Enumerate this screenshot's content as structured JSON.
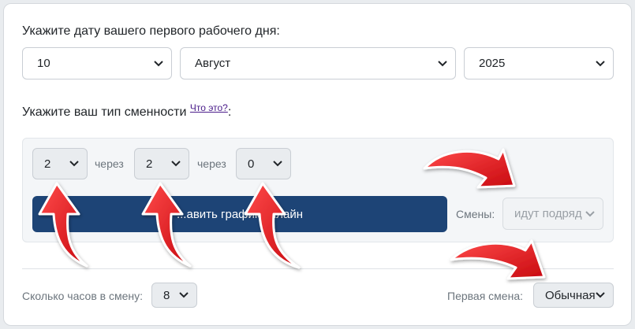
{
  "form": {
    "date_label": "Укажите дату вашего первого рабочего дня:",
    "day": "10",
    "month": "Август",
    "year": "2025",
    "shift_label": "Укажите ваш тип сменности",
    "what_link": "Что это?",
    "colon": ":",
    "pattern": {
      "a": "2",
      "through1": "через",
      "b": "2",
      "through2": "через",
      "c": "0"
    },
    "button_label": "...авить график онлайн",
    "shifts_label": "Смены:",
    "shifts_value": "идут подряд",
    "hours_label": "Сколько часов в смену:",
    "hours_value": "8",
    "first_shift_label": "Первая смена:",
    "first_shift_value": "Обычная"
  },
  "colors": {
    "button": "#1d4476",
    "arrow": "#e8141a",
    "panel": "#f4f6f8"
  },
  "annotations": [
    "red-arrow-icon",
    "red-arrow-icon",
    "red-arrow-icon",
    "red-arrow-icon",
    "red-arrow-icon"
  ]
}
